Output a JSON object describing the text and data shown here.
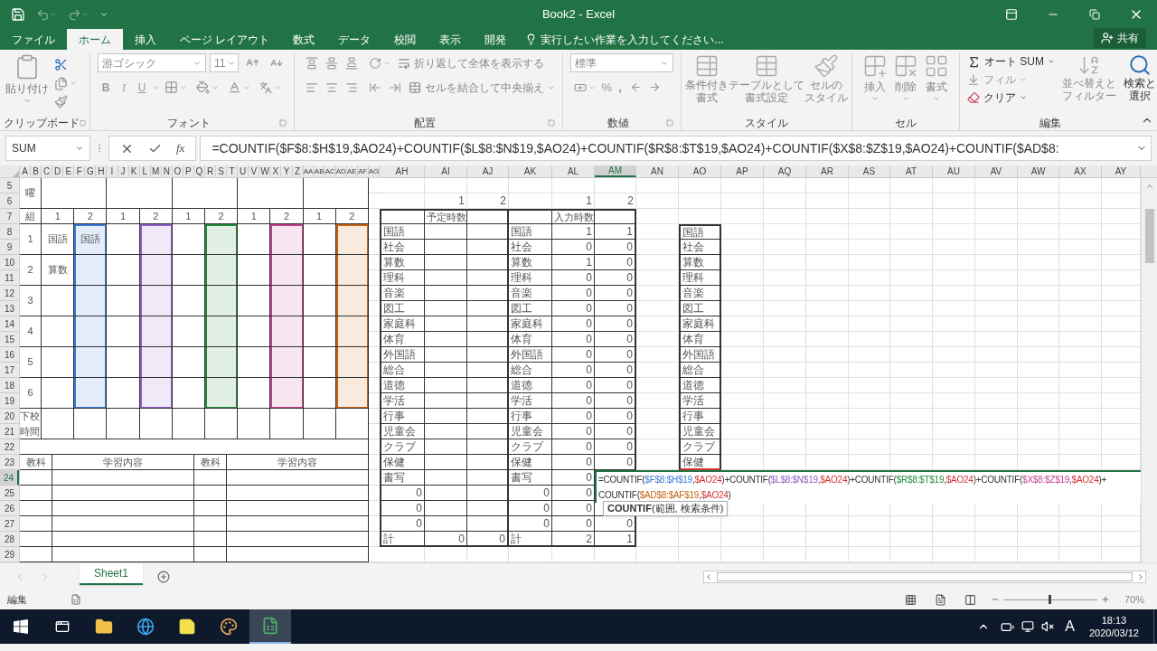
{
  "title_bar": {
    "title": "Book2 - Excel"
  },
  "tabs": [
    {
      "label": "ファイル",
      "selected": false
    },
    {
      "label": "ホーム",
      "selected": true
    },
    {
      "label": "挿入",
      "selected": false
    },
    {
      "label": "ページ レイアウト",
      "selected": false
    },
    {
      "label": "数式",
      "selected": false
    },
    {
      "label": "データ",
      "selected": false
    },
    {
      "label": "校閲",
      "selected": false
    },
    {
      "label": "表示",
      "selected": false
    },
    {
      "label": "開発",
      "selected": false
    }
  ],
  "tell_me": "実行したい作業を入力してください...",
  "share": "共有",
  "ribbon": {
    "clipboard": {
      "paste": "貼り付け",
      "label": "クリップボード"
    },
    "font": {
      "name": "游ゴシック",
      "size": "11",
      "bold": "B",
      "italic": "I",
      "underline": "U",
      "label": "フォント"
    },
    "alignment": {
      "wrap": "折り返して全体を表示する",
      "merge": "セルを結合して中央揃え",
      "label": "配置"
    },
    "number": {
      "format": "標準",
      "percent": "%",
      "comma": ",",
      "label": "数値"
    },
    "styles": {
      "items": [
        [
          "条件付き",
          "書式"
        ],
        [
          "テーブルとして",
          "書式設定"
        ],
        [
          "セルの",
          "スタイル"
        ]
      ],
      "label": "スタイル"
    },
    "cells": {
      "items": [
        "挿入",
        "削除",
        "書式"
      ],
      "label": "セル"
    },
    "editing": {
      "autosum": "オート SUM",
      "fill": "フィル",
      "clear": "クリア",
      "sort": [
        "並べ替えと",
        "フィルター"
      ],
      "find": [
        "検索と",
        "選択"
      ],
      "label": "編集"
    }
  },
  "name_box": "SUM",
  "fx": "fx",
  "formula": "=COUNTIF($F$8:$H$19,$AO24)+COUNTIF($L$8:$N$19,$AO24)+COUNTIF($R$8:$T$19,$AO24)+COUNTIF($X$8:$Z$19,$AO24)+COUNTIF($AD$8:",
  "sheet": {
    "columns_left": [
      {
        "label": "A",
        "selected": false
      },
      {
        "label": "B",
        "selected": false
      },
      {
        "label": "C",
        "selected": false
      },
      {
        "label": "D",
        "selected": false
      },
      {
        "label": "E",
        "selected": false
      },
      {
        "label": "F",
        "selected": false
      },
      {
        "label": "G",
        "selected": false
      },
      {
        "label": "H",
        "selected": false
      },
      {
        "label": "I",
        "selected": false
      },
      {
        "label": "J",
        "selected": false
      },
      {
        "label": "K",
        "selected": false
      },
      {
        "label": "L",
        "selected": false
      },
      {
        "label": "M",
        "selected": false
      },
      {
        "label": "N",
        "selected": false
      },
      {
        "label": "O",
        "selected": false
      },
      {
        "label": "P",
        "selected": false
      },
      {
        "label": "Q",
        "selected": false
      },
      {
        "label": "R",
        "selected": false
      },
      {
        "label": "S",
        "selected": false
      },
      {
        "label": "T",
        "selected": false
      },
      {
        "label": "U",
        "selected": false
      },
      {
        "label": "V",
        "selected": false
      },
      {
        "label": "W",
        "selected": false
      },
      {
        "label": "X",
        "selected": false
      },
      {
        "label": "Y",
        "selected": false
      },
      {
        "label": "Z",
        "selected": false
      },
      {
        "label": "AA",
        "selected": false
      },
      {
        "label": "AB",
        "selected": false
      },
      {
        "label": "AC",
        "selected": false
      },
      {
        "label": "AD",
        "selected": false
      },
      {
        "label": "AE",
        "selected": false
      },
      {
        "label": "AF",
        "selected": false
      },
      {
        "label": "AG",
        "selected": false
      }
    ],
    "columns_right": [
      {
        "label": "AH",
        "selected": false
      },
      {
        "label": "AI",
        "selected": false
      },
      {
        "label": "AJ",
        "selected": false
      },
      {
        "label": "AK",
        "selected": false
      },
      {
        "label": "AL",
        "selected": false
      },
      {
        "label": "AM",
        "selected": true
      },
      {
        "label": "AN",
        "selected": false
      },
      {
        "label": "AO",
        "selected": false
      },
      {
        "label": "AP",
        "selected": false
      },
      {
        "label": "AQ",
        "selected": false
      },
      {
        "label": "AR",
        "selected": false
      },
      {
        "label": "AS",
        "selected": false
      },
      {
        "label": "AT",
        "selected": false
      },
      {
        "label": "AU",
        "selected": false
      },
      {
        "label": "AV",
        "selected": false
      },
      {
        "label": "AW",
        "selected": false
      },
      {
        "label": "AX",
        "selected": false
      },
      {
        "label": "AY",
        "selected": false
      }
    ],
    "rows": [
      {
        "label": "5",
        "selected": false
      },
      {
        "label": "6",
        "selected": false
      },
      {
        "label": "7",
        "selected": false
      },
      {
        "label": "8",
        "selected": false
      },
      {
        "label": "9",
        "selected": false
      },
      {
        "label": "10",
        "selected": false
      },
      {
        "label": "11",
        "selected": false
      },
      {
        "label": "12",
        "selected": false
      },
      {
        "label": "13",
        "selected": false
      },
      {
        "label": "14",
        "selected": false
      },
      {
        "label": "15",
        "selected": false
      },
      {
        "label": "16",
        "selected": false
      },
      {
        "label": "17",
        "selected": false
      },
      {
        "label": "18",
        "selected": false
      },
      {
        "label": "19",
        "selected": false
      },
      {
        "label": "20",
        "selected": false
      },
      {
        "label": "21",
        "selected": false
      },
      {
        "label": "22",
        "selected": false
      },
      {
        "label": "23",
        "selected": false
      },
      {
        "label": "24",
        "selected": true
      },
      {
        "label": "25",
        "selected": false
      },
      {
        "label": "26",
        "selected": false
      },
      {
        "label": "27",
        "selected": false
      },
      {
        "label": "28",
        "selected": false
      },
      {
        "label": "29",
        "selected": false
      }
    ],
    "timetable": {
      "day_label": "曜",
      "group_label": "組",
      "groups": [
        {
          "label": "1"
        },
        {
          "label": "2",
          "color": "#3b78d8"
        },
        {
          "label": "1"
        },
        {
          "label": "2",
          "color": "#8e5cc8"
        },
        {
          "label": "1"
        },
        {
          "label": "2",
          "color": "#1e8a3a"
        },
        {
          "label": "1"
        },
        {
          "label": "2",
          "color": "#c0408a"
        },
        {
          "label": "1"
        },
        {
          "label": "2",
          "color": "#c8620e"
        }
      ],
      "periods": [
        {
          "label": "1",
          "cells": [
            {
              "text": "国語"
            },
            {
              "text": "国語"
            },
            {},
            {},
            {},
            {},
            {},
            {},
            {},
            {}
          ]
        },
        {
          "label": "2",
          "cells": [
            {
              "text": "算数"
            },
            {},
            {},
            {},
            {},
            {},
            {},
            {},
            {},
            {}
          ]
        },
        {
          "label": "3",
          "cells": [
            {},
            {},
            {},
            {},
            {},
            {},
            {},
            {},
            {},
            {}
          ]
        },
        {
          "label": "4",
          "cells": [
            {},
            {},
            {},
            {},
            {},
            {},
            {},
            {},
            {},
            {}
          ]
        },
        {
          "label": "5",
          "cells": [
            {},
            {},
            {},
            {},
            {},
            {},
            {},
            {},
            {},
            {}
          ]
        },
        {
          "label": "6",
          "cells": [
            {},
            {},
            {},
            {},
            {},
            {},
            {},
            {},
            {},
            {}
          ]
        }
      ],
      "dismissal_labels": [
        "下校",
        "時間"
      ],
      "notes_headers": [
        "教科",
        "学習内容",
        "教科",
        "学習内容"
      ]
    },
    "summary_rows": [
      {},
      {
        "AI": {
          "text": "1",
          "kind": "number"
        },
        "AJ": {
          "text": "2",
          "kind": "number"
        },
        "AL": {
          "text": "1",
          "kind": "number"
        },
        "AM": {
          "text": "2",
          "kind": "number"
        }
      },
      {
        "AI": {
          "text": "予定時数",
          "kind": "label"
        },
        "AL": {
          "text": "入力時数",
          "kind": "label"
        }
      },
      {
        "AH": {
          "text": "国語",
          "kind": "label"
        },
        "AK": {
          "text": "国語",
          "kind": "label"
        },
        "AL": {
          "text": "1",
          "kind": "number"
        },
        "AM": {
          "text": "1",
          "kind": "number"
        },
        "AO": {
          "text": "国語",
          "kind": "label"
        }
      },
      {
        "AH": {
          "text": "社会",
          "kind": "label"
        },
        "AK": {
          "text": "社会",
          "kind": "label"
        },
        "AL": {
          "text": "0",
          "kind": "number"
        },
        "AM": {
          "text": "0",
          "kind": "number"
        },
        "AO": {
          "text": "社会",
          "kind": "label"
        }
      },
      {
        "AH": {
          "text": "算数",
          "kind": "label"
        },
        "AK": {
          "text": "算数",
          "kind": "label"
        },
        "AL": {
          "text": "1",
          "kind": "number"
        },
        "AM": {
          "text": "0",
          "kind": "number"
        },
        "AO": {
          "text": "算数",
          "kind": "label"
        }
      },
      {
        "AH": {
          "text": "理科",
          "kind": "label"
        },
        "AK": {
          "text": "理科",
          "kind": "label"
        },
        "AL": {
          "text": "0",
          "kind": "number"
        },
        "AM": {
          "text": "0",
          "kind": "number"
        },
        "AO": {
          "text": "理科",
          "kind": "label"
        }
      },
      {
        "AH": {
          "text": "音楽",
          "kind": "label"
        },
        "AK": {
          "text": "音楽",
          "kind": "label"
        },
        "AL": {
          "text": "0",
          "kind": "number"
        },
        "AM": {
          "text": "0",
          "kind": "number"
        },
        "AO": {
          "text": "音楽",
          "kind": "label"
        }
      },
      {
        "AH": {
          "text": "図工",
          "kind": "label"
        },
        "AK": {
          "text": "図工",
          "kind": "label"
        },
        "AL": {
          "text": "0",
          "kind": "number"
        },
        "AM": {
          "text": "0",
          "kind": "number"
        },
        "AO": {
          "text": "図工",
          "kind": "label"
        }
      },
      {
        "AH": {
          "text": "家庭科",
          "kind": "label"
        },
        "AK": {
          "text": "家庭科",
          "kind": "label"
        },
        "AL": {
          "text": "0",
          "kind": "number"
        },
        "AM": {
          "text": "0",
          "kind": "number"
        },
        "AO": {
          "text": "家庭科",
          "kind": "label"
        }
      },
      {
        "AH": {
          "text": "体育",
          "kind": "label"
        },
        "AK": {
          "text": "体育",
          "kind": "label"
        },
        "AL": {
          "text": "0",
          "kind": "number"
        },
        "AM": {
          "text": "0",
          "kind": "number"
        },
        "AO": {
          "text": "体育",
          "kind": "label"
        }
      },
      {
        "AH": {
          "text": "外国語",
          "kind": "label"
        },
        "AK": {
          "text": "外国語",
          "kind": "label"
        },
        "AL": {
          "text": "0",
          "kind": "number"
        },
        "AM": {
          "text": "0",
          "kind": "number"
        },
        "AO": {
          "text": "外国語",
          "kind": "label"
        }
      },
      {
        "AH": {
          "text": "総合",
          "kind": "label"
        },
        "AK": {
          "text": "総合",
          "kind": "label"
        },
        "AL": {
          "text": "0",
          "kind": "number"
        },
        "AM": {
          "text": "0",
          "kind": "number"
        },
        "AO": {
          "text": "総合",
          "kind": "label"
        }
      },
      {
        "AH": {
          "text": "道徳",
          "kind": "label"
        },
        "AK": {
          "text": "道徳",
          "kind": "label"
        },
        "AL": {
          "text": "0",
          "kind": "number"
        },
        "AM": {
          "text": "0",
          "kind": "number"
        },
        "AO": {
          "text": "道徳",
          "kind": "label"
        }
      },
      {
        "AH": {
          "text": "学活",
          "kind": "label"
        },
        "AK": {
          "text": "学活",
          "kind": "label"
        },
        "AL": {
          "text": "0",
          "kind": "number"
        },
        "AM": {
          "text": "0",
          "kind": "number"
        },
        "AO": {
          "text": "学活",
          "kind": "label"
        }
      },
      {
        "AH": {
          "text": "行事",
          "kind": "label"
        },
        "AK": {
          "text": "行事",
          "kind": "label"
        },
        "AL": {
          "text": "0",
          "kind": "number"
        },
        "AM": {
          "text": "0",
          "kind": "number"
        },
        "AO": {
          "text": "行事",
          "kind": "label"
        }
      },
      {
        "AH": {
          "text": "児童会",
          "kind": "label"
        },
        "AK": {
          "text": "児童会",
          "kind": "label"
        },
        "AL": {
          "text": "0",
          "kind": "number"
        },
        "AM": {
          "text": "0",
          "kind": "number"
        },
        "AO": {
          "text": "児童会",
          "kind": "label"
        }
      },
      {
        "AH": {
          "text": "クラブ",
          "kind": "label"
        },
        "AK": {
          "text": "クラブ",
          "kind": "label"
        },
        "AL": {
          "text": "0",
          "kind": "number"
        },
        "AM": {
          "text": "0",
          "kind": "number"
        },
        "AO": {
          "text": "クラブ",
          "kind": "label"
        }
      },
      {
        "AH": {
          "text": "保健",
          "kind": "label"
        },
        "AK": {
          "text": "保健",
          "kind": "label"
        },
        "AL": {
          "text": "0",
          "kind": "number"
        },
        "AM": {
          "text": "0",
          "kind": "number"
        },
        "AO": {
          "text": "保健",
          "kind": "label"
        }
      },
      {
        "AH": {
          "text": "書写",
          "kind": "label"
        },
        "AK": {
          "text": "書写",
          "kind": "label"
        },
        "AL": {
          "text": "0",
          "kind": "number"
        }
      },
      {
        "AH": {
          "text": "0",
          "kind": "number"
        },
        "AK": {
          "text": "0",
          "kind": "number"
        },
        "AL": {
          "text": "0",
          "kind": "number"
        }
      },
      {
        "AH": {
          "text": "0",
          "kind": "number"
        },
        "AK": {
          "text": "0",
          "kind": "number"
        },
        "AL": {
          "text": "0",
          "kind": "number"
        }
      },
      {
        "AH": {
          "text": "0",
          "kind": "number"
        },
        "AK": {
          "text": "0",
          "kind": "number"
        },
        "AL": {
          "text": "0",
          "kind": "number"
        },
        "AM": {
          "text": "0",
          "kind": "number"
        }
      },
      {
        "AH": {
          "text": "計",
          "kind": "label"
        },
        "AI": {
          "text": "0",
          "kind": "number"
        },
        "AJ": {
          "text": "0",
          "kind": "number"
        },
        "AK": {
          "text": "計",
          "kind": "label"
        },
        "AL": {
          "text": "2",
          "kind": "number"
        },
        "AM": {
          "text": "1",
          "kind": "number"
        }
      },
      {}
    ],
    "cell_editor": {
      "lines": [
        [
          {
            "text": "=COUNTIF(",
            "kind": "text"
          },
          {
            "text": "$F$8:$H$19",
            "kind": "range",
            "color": "#3b78d8"
          },
          {
            "text": ",",
            "kind": "text"
          },
          {
            "text": "$AO24",
            "kind": "cell",
            "color": "#d03030"
          },
          {
            "text": ")+COUNTIF(",
            "kind": "text"
          },
          {
            "text": "$L$8:$N$19",
            "kind": "range",
            "color": "#8e5cc8"
          },
          {
            "text": ",",
            "kind": "text"
          },
          {
            "text": "$AO24",
            "kind": "cell",
            "color": "#d03030"
          },
          {
            "text": ")+COUNTIF(",
            "kind": "text"
          },
          {
            "text": "$R$8:$T$19",
            "kind": "range",
            "color": "#1e8a3a"
          },
          {
            "text": ",",
            "kind": "text"
          },
          {
            "text": "$AO24",
            "kind": "cell",
            "color": "#d03030"
          },
          {
            "text": ")+COUNTIF(",
            "kind": "text"
          },
          {
            "text": "$X$8:$Z$19",
            "kind": "range",
            "color": "#c0408a"
          },
          {
            "text": ",",
            "kind": "text"
          },
          {
            "text": "$AO24",
            "kind": "cell",
            "color": "#d03030"
          },
          {
            "text": ")+",
            "kind": "text"
          }
        ],
        [
          {
            "text": "COUNTIF(",
            "kind": "text"
          },
          {
            "text": "$AD$8:$AF$19",
            "kind": "range",
            "color": "#c8620e"
          },
          {
            "text": ",",
            "kind": "text"
          },
          {
            "text": "$AO24",
            "kind": "cell",
            "color": "#d03030"
          },
          {
            "text": ")",
            "kind": "text"
          }
        ]
      ],
      "tooltip": "**COUNTIF**(範囲, 検索条件)"
    }
  },
  "sheet_tabs": [
    {
      "label": "Sheet1",
      "selected": true
    }
  ],
  "status_bar": {
    "mode": "編集",
    "zoom": {
      "level": 0.48,
      "reading": "70%"
    }
  },
  "taskbar": {
    "time": "18:13",
    "date": "2020/03/12",
    "ime": "A"
  }
}
